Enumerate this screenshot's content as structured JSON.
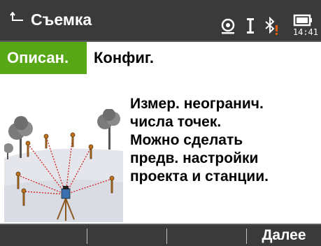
{
  "title_bar": {
    "title": "Съемка",
    "icons": [
      "back-icon",
      "atr-prism-icon",
      "compensator-icon",
      "bluetooth-warning-icon",
      "battery-icon"
    ],
    "time": "14:41",
    "colors": {
      "background": "#3a3a3a",
      "warning": "#e06010"
    }
  },
  "tabs": [
    {
      "label": "Описан.",
      "active": true
    },
    {
      "label": "Конфиг.",
      "active": false
    }
  ],
  "accent_color": "#58a716",
  "content": {
    "illustration": "total-station-survey-illustration",
    "description_lines": [
      "Измер. неогранич.",
      "числа точек.",
      "Можно сделать",
      "предв. настройки",
      "проекта и станции."
    ]
  },
  "softkeys": [
    "",
    "",
    "",
    "Далее"
  ]
}
